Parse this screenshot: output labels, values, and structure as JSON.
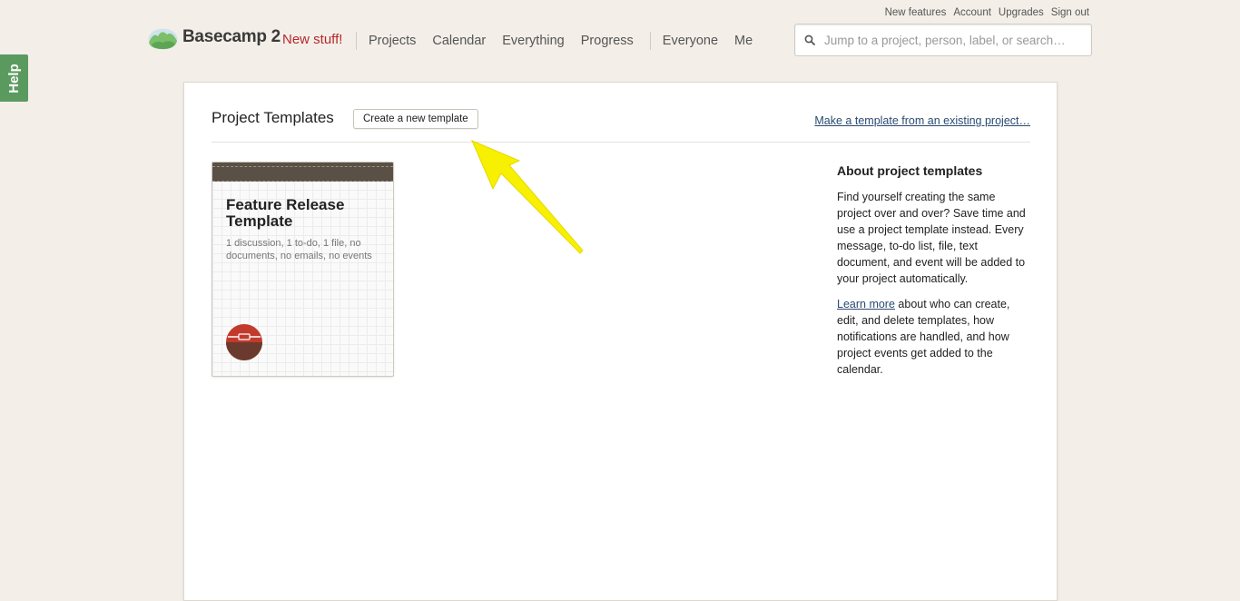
{
  "help": {
    "label": "Help"
  },
  "utility_links": [
    "New features",
    "Account",
    "Upgrades",
    "Sign out"
  ],
  "header": {
    "logo_text": "Basecamp 2",
    "new_stuff": "New stuff!",
    "nav_primary": [
      "Projects",
      "Calendar",
      "Everything",
      "Progress"
    ],
    "nav_secondary": [
      "Everyone",
      "Me"
    ],
    "search_placeholder": "Jump to a project, person, label, or search…"
  },
  "page": {
    "title": "Project Templates",
    "create_button": "Create a new template",
    "make_link": "Make a template from an existing project…"
  },
  "templates": [
    {
      "title": "Feature Release Template",
      "description": "1 discussion, 1 to-do, 1 file, no documents, no emails, no events"
    }
  ],
  "about": {
    "heading": "About project templates",
    "paragraph1": "Find yourself creating the same project over and over? Save time and use a project template instead. Every message, to-do list, file, text document, and event will be added to your project automatically.",
    "learn_more": "Learn more",
    "paragraph2_rest": " about who can create, edit, and delete templates, how notifications are handled, and how project events get added to the calendar."
  },
  "colors": {
    "background": "#f3efe8",
    "new_stuff": "#b5282b",
    "help_tab": "#5a9a5f",
    "link": "#2b4a72",
    "arrow": "#f7f000"
  }
}
